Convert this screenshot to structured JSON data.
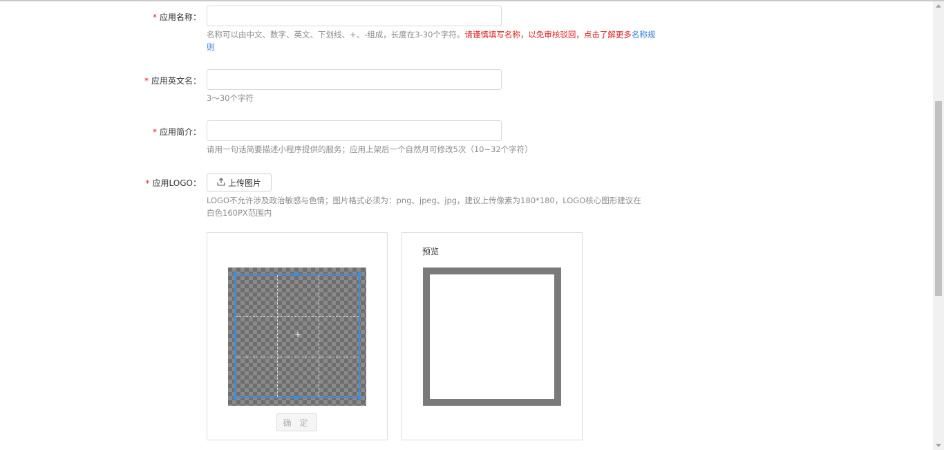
{
  "form": {
    "app_name": {
      "required_mark": "*",
      "label": "应用名称：",
      "value": "",
      "hint_prefix": "名称可以由中文、数字、英文、下划线、+、-组成，长度在3-30个字符。",
      "hint_warn": "请谨慎填写名称，以免审核驳回，点击了解更多",
      "hint_link": "名称规则"
    },
    "app_english_name": {
      "required_mark": "*",
      "label": "应用英文名：",
      "value": "",
      "hint": "3～30个字符"
    },
    "app_intro": {
      "required_mark": "*",
      "label": "应用简介：",
      "value": "",
      "hint": "请用一句话简要描述小程序提供的服务；应用上架后一个自然月可修改5次（10~32个字符）"
    },
    "app_logo": {
      "required_mark": "*",
      "label": "应用LOGO：",
      "upload_button": "上传图片",
      "hint": "LOGO不允许涉及政治敏感与色情；图片格式必须为：png、jpeg、jpg，建议上传像素为180*180，LOGO核心图形建议在白色160PX范围内"
    }
  },
  "cropper": {
    "confirm_button": "确 定",
    "crop_center_symbol": "+"
  },
  "preview": {
    "title": "预览"
  },
  "colors": {
    "required": "#e02020",
    "warning": "#e02020",
    "link": "#2b7bd6",
    "hint": "#8c8c8c",
    "crop_border": "#3a8ee6"
  },
  "icons": {
    "upload": "upload-icon"
  }
}
